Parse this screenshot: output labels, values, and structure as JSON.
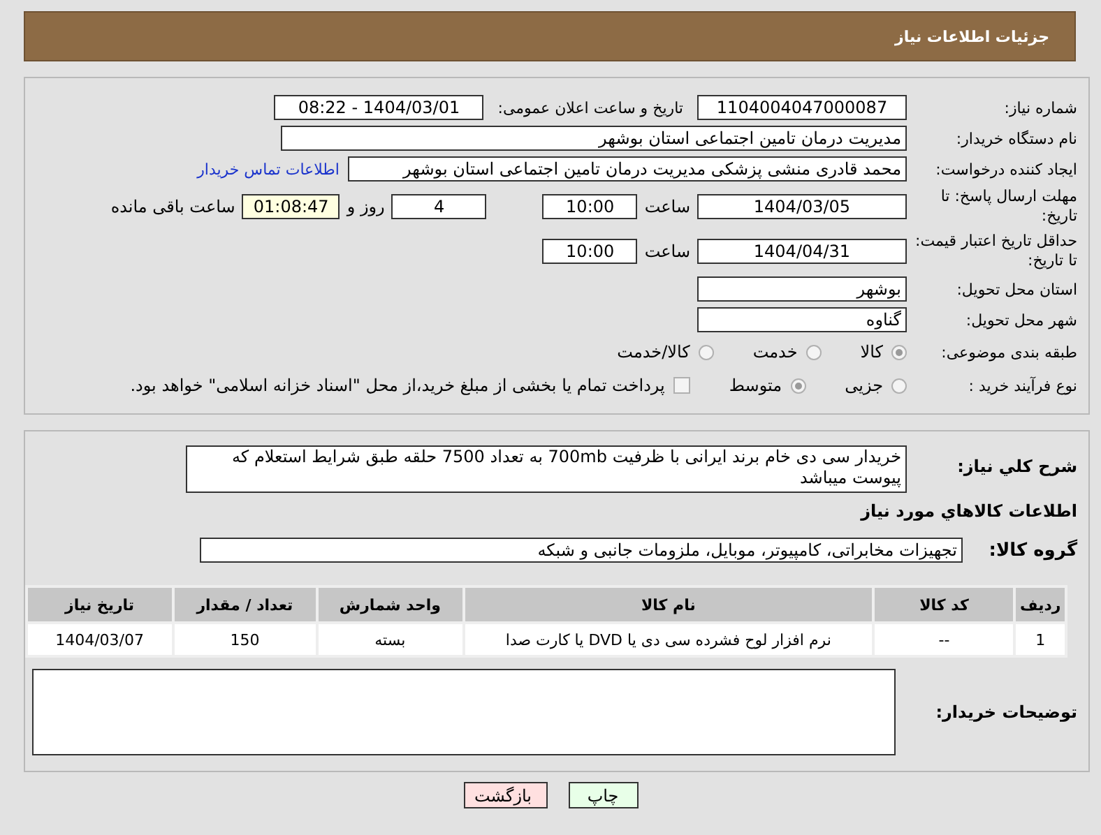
{
  "page_title": "جزئیات اطلاعات نیاز",
  "need_number": {
    "label": "شماره نیاز:",
    "value": "1104004047000087"
  },
  "announce": {
    "label": "تاریخ و ساعت اعلان عمومی:",
    "value": "1404/03/01 - 08:22"
  },
  "buyer_org": {
    "label": "نام دستگاه خریدار:",
    "value": "مدیریت درمان تامین اجتماعی استان بوشهر"
  },
  "requester": {
    "label": "ایجاد کننده درخواست:",
    "value": "محمد قادری منشی پزشکی مدیریت درمان تامین اجتماعی استان بوشهر",
    "link": "اطلاعات تماس خریدار"
  },
  "reply_deadline": {
    "label": "مهلت ارسال پاسخ: تا تاریخ:",
    "date": "1404/03/05",
    "time_label": "ساعت",
    "time": "10:00",
    "days": "4",
    "days_label": "روز و",
    "remaining": "01:08:47",
    "remaining_label": "ساعت باقی مانده"
  },
  "price_validity": {
    "label": "حداقل تاریخ اعتبار قیمت: تا تاریخ:",
    "date": "1404/04/31",
    "time_label": "ساعت",
    "time": "10:00"
  },
  "province": {
    "label": "استان محل تحویل:",
    "value": "بوشهر"
  },
  "city": {
    "label": "شهر محل تحویل:",
    "value": "گناوه"
  },
  "category": {
    "label": "طبقه بندی موضوعی:",
    "options": [
      {
        "label": "کالا",
        "selected": true
      },
      {
        "label": "خدمت",
        "selected": false
      },
      {
        "label": "کالا/خدمت",
        "selected": false
      }
    ]
  },
  "purchase_type": {
    "label": "نوع فرآیند خرید :",
    "options": [
      {
        "label": "جزیی",
        "selected": false
      },
      {
        "label": "متوسط",
        "selected": true
      }
    ],
    "treasury": {
      "label": "پرداخت تمام یا بخشی از مبلغ خرید،از محل \"اسناد خزانه اسلامی\" خواهد بود.",
      "checked": false
    }
  },
  "description": {
    "label": "شرح کلي نياز:",
    "value": "خریدار سی دی خام برند ایرانی با ظرفیت 700mb  به تعداد 7500 حلقه طبق شرایط استعلام که پیوست میباشد"
  },
  "goods_heading": "اطلاعات کالاهاي مورد نياز",
  "goods_group": {
    "label": "گروه کالا:",
    "value": "تجهیزات مخابراتی، کامپیوتر، موبایل، ملزومات جانبی و شبکه"
  },
  "table": {
    "columns": [
      "ردیف",
      "کد کالا",
      "نام کالا",
      "واحد شمارش",
      "تعداد / مقدار",
      "تاریخ نیاز"
    ],
    "rows": [
      [
        "1",
        "--",
        "نرم افزار لوح فشرده سی دی یا DVD یا کارت صدا",
        "بسته",
        "150",
        "1404/03/07"
      ]
    ]
  },
  "buyer_notes": {
    "label": "توضیحات خریدار:"
  },
  "buttons": [
    {
      "label": "چاپ",
      "kind": "print"
    },
    {
      "label": "بازگشت",
      "kind": "back"
    }
  ]
}
